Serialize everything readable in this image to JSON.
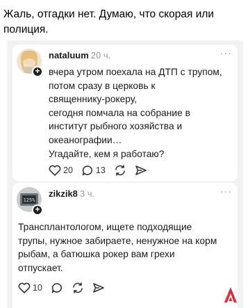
{
  "caption": {
    "line1": "Жаль, отгадки нет. Думаю, что скорая или",
    "line2": "полиция."
  },
  "comment1": {
    "author": "nataluum",
    "time": "20 ч.",
    "more": "···",
    "lines": [
      "вчера утром поехала на ДТП с трупом,",
      "потом сразу в церковь к",
      "священнику-рокеру,",
      "сегодня помчала на собрание в",
      "институт рыбного хозяйства и",
      "океанографии…",
      "Угадайте, кем я работаю?"
    ],
    "likes": "20",
    "replies": "13"
  },
  "comment2": {
    "author": "zikzik8",
    "time": "3 ч.",
    "more": "···",
    "avatar_text": "125%",
    "lines": [
      "Трансплантологом, ищете подходящие",
      "трупы, нужное забираете, ненужное на корм",
      "рыбам, а батюшка рокер вам грехи",
      "отпускает."
    ],
    "likes": "10"
  },
  "icons": {
    "like": "heart-icon",
    "reply": "speech-bubble-icon",
    "repost": "repost-icon",
    "share": "send-icon",
    "follow": "plus-icon",
    "brand": "brand-logo-icon"
  },
  "colors": {
    "panel_bg": "#f2f2f2",
    "card_bg": "#ffffff",
    "muted": "#9a9a9a",
    "brand": "#e0283c"
  }
}
